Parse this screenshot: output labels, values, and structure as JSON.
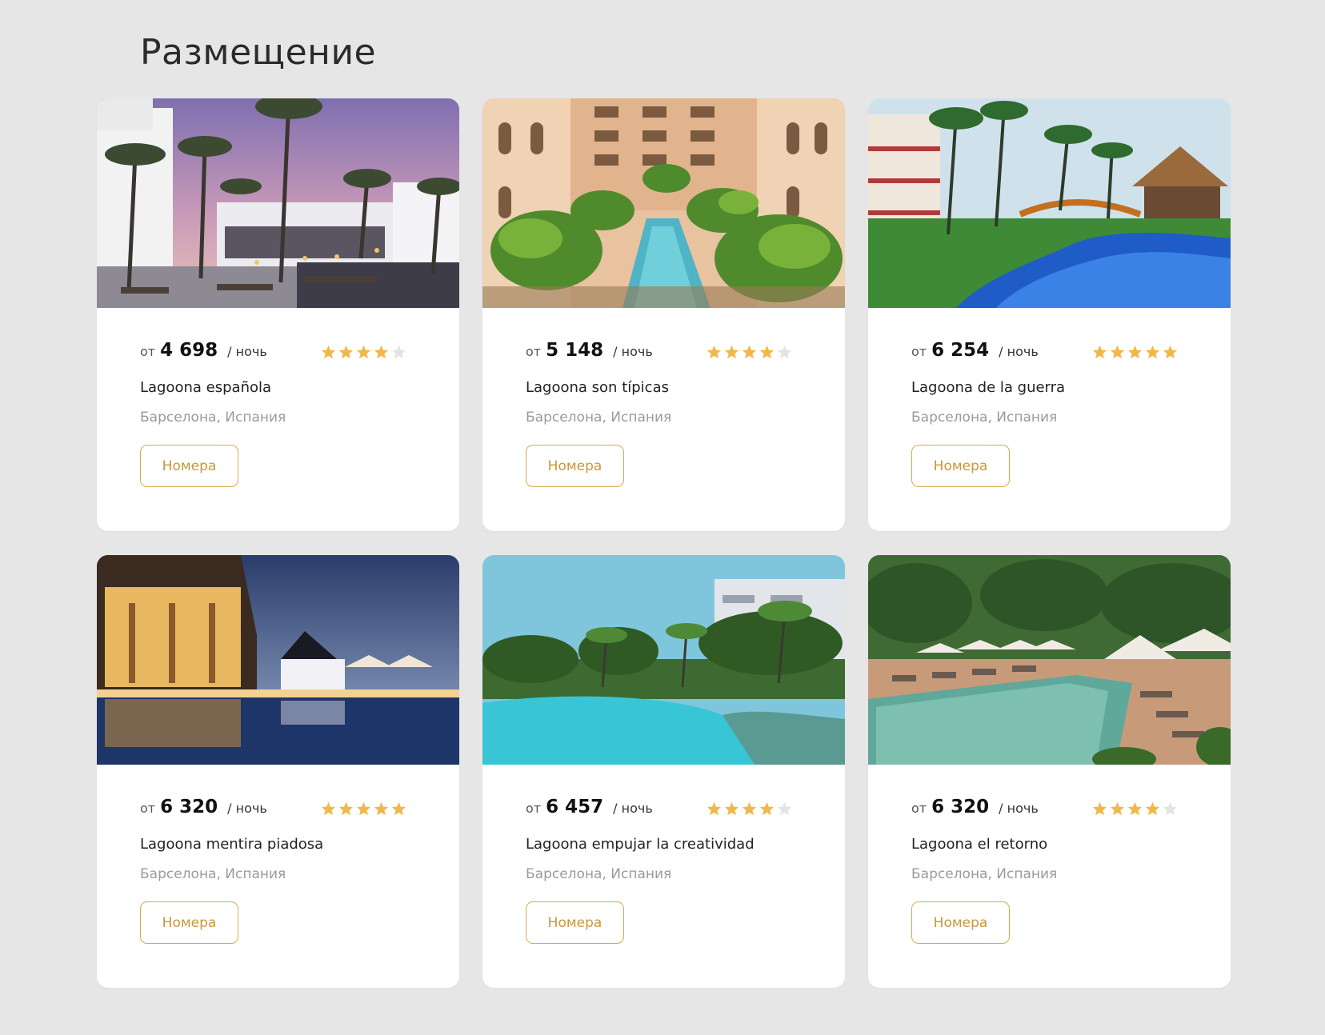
{
  "title": "Размещение",
  "colors": {
    "background": "#e6e6e6",
    "card": "#ffffff",
    "accent": "#d9a94a",
    "star_filled": "#f0b84a",
    "star_empty": "#e3e3e3",
    "muted_text": "#9a9a9a"
  },
  "cards": [
    {
      "photo": "hotel-photo-palms-sunset",
      "price_prefix": "от",
      "price": "4 698",
      "price_suffix": "/ ночь",
      "rating": 4,
      "name": "Lagoona española",
      "location": "Барселона, Испания",
      "button_label": "Номера"
    },
    {
      "photo": "hotel-photo-courtyard-pool",
      "price_prefix": "от",
      "price": "5 148",
      "price_suffix": "/ ночь",
      "rating": 4,
      "name": "Lagoona son típicas",
      "location": "Барселона, Испания",
      "button_label": "Номера"
    },
    {
      "photo": "hotel-photo-lagoon-bridge",
      "price_prefix": "от",
      "price": "6 254",
      "price_suffix": "/ ночь",
      "rating": 5,
      "name": "Lagoona de la guerra",
      "location": "Барселона, Испания",
      "button_label": "Номера"
    },
    {
      "photo": "hotel-photo-night-reflection",
      "price_prefix": "от",
      "price": "6 320",
      "price_suffix": "/ ночь",
      "rating": 5,
      "name": "Lagoona mentira piadosa",
      "location": "Барселона, Испания",
      "button_label": "Номера"
    },
    {
      "photo": "hotel-photo-turquoise-pool",
      "price_prefix": "от",
      "price": "6 457",
      "price_suffix": "/ ночь",
      "rating": 4,
      "name": "Lagoona empujar la creatividad",
      "location": "Барселона, Испания",
      "button_label": "Номера"
    },
    {
      "photo": "hotel-photo-umbrellas-pool",
      "price_prefix": "от",
      "price": "6 320",
      "price_suffix": "/ ночь",
      "rating": 4,
      "name": "Lagoona el retorno",
      "location": "Барселона, Испания",
      "button_label": "Номера"
    }
  ]
}
